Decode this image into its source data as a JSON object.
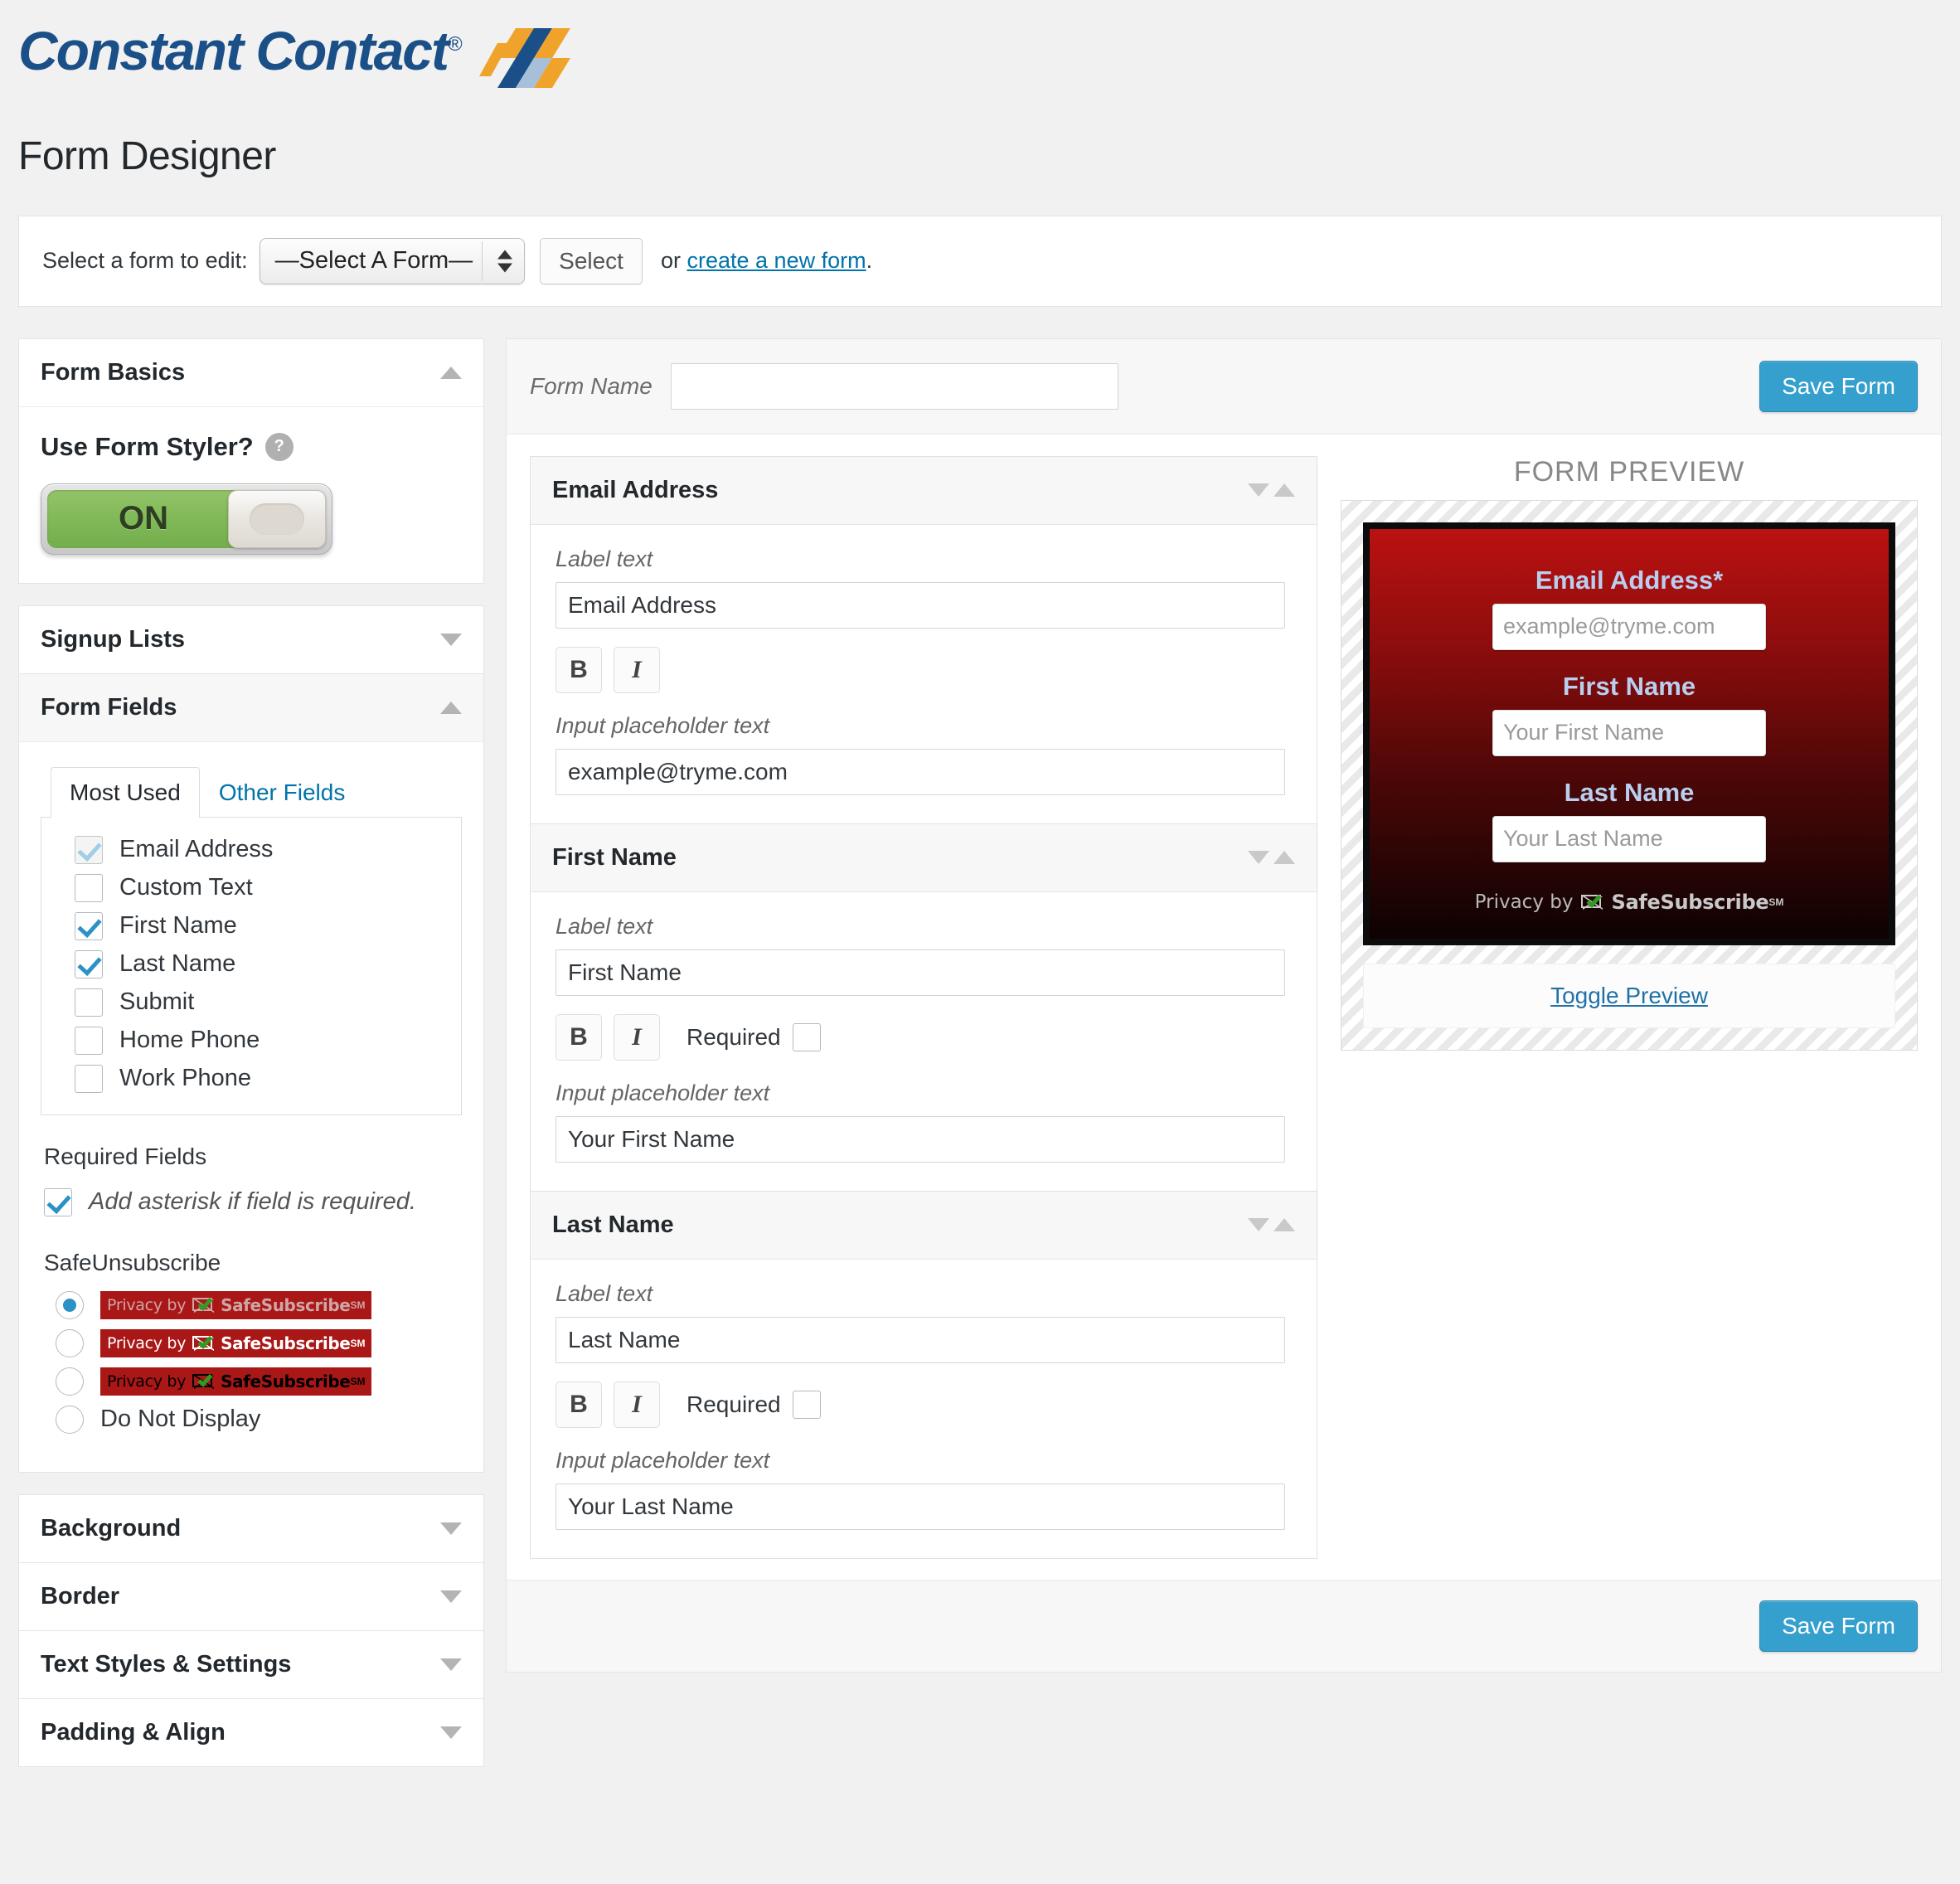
{
  "brand": {
    "name": "Constant Contact",
    "registered_mark": "®"
  },
  "page": {
    "title": "Form Designer"
  },
  "selector": {
    "label": "Select a form to edit:",
    "selected_option": "—Select A Form—",
    "options": [
      "—Select A Form—"
    ],
    "select_button": "Select",
    "or_text": "or",
    "create_link": "create a new form",
    "period": "."
  },
  "sidebar": {
    "form_basics": {
      "title": "Form Basics",
      "styler_question": "Use Form Styler?",
      "help_icon": "question-mark-icon",
      "toggle_state": "ON"
    },
    "signup_lists": {
      "title": "Signup Lists"
    },
    "form_fields": {
      "title": "Form Fields",
      "tabs": [
        {
          "label": "Most Used",
          "active": true
        },
        {
          "label": "Other Fields",
          "active": false
        }
      ],
      "checkboxes": [
        {
          "label": "Email Address",
          "checked": true,
          "disabled": true
        },
        {
          "label": "Custom Text",
          "checked": false,
          "disabled": false
        },
        {
          "label": "First Name",
          "checked": true,
          "disabled": false
        },
        {
          "label": "Last Name",
          "checked": true,
          "disabled": false
        },
        {
          "label": "Submit",
          "checked": false,
          "disabled": false
        },
        {
          "label": "Home Phone",
          "checked": false,
          "disabled": false
        },
        {
          "label": "Work Phone",
          "checked": false,
          "disabled": false
        }
      ],
      "required_fields_title": "Required Fields",
      "asterisk_label": "Add asterisk if field is required.",
      "asterisk_checked": true,
      "safeunsubscribe_title": "SafeUnsubscribe",
      "badge_privacy_text": "Privacy by",
      "badge_name": "SafeSubscribe",
      "badge_sm": "SM",
      "safeunsubscribe_options": [
        {
          "style": "grey",
          "selected": true
        },
        {
          "style": "white",
          "selected": false
        },
        {
          "style": "black",
          "selected": false
        }
      ],
      "do_not_display_label": "Do Not Display",
      "do_not_display_selected": false
    },
    "collapsed_sections": [
      {
        "title": "Background"
      },
      {
        "title": "Border"
      },
      {
        "title": "Text Styles & Settings"
      },
      {
        "title": "Padding & Align"
      }
    ]
  },
  "content": {
    "form_name_label": "Form Name",
    "form_name_value": "",
    "form_name_placeholder": "",
    "save_button_top": "Save Form",
    "save_button_bottom": "Save Form",
    "label_text_label": "Label text",
    "placeholder_text_label": "Input placeholder text",
    "bold_button": "B",
    "italic_button": "I",
    "required_label": "Required",
    "fields": [
      {
        "title": "Email Address",
        "label_text": "Email Address",
        "placeholder_text": "example@tryme.com",
        "has_required": false,
        "required_checked": false
      },
      {
        "title": "First Name",
        "label_text": "First Name",
        "placeholder_text": "Your First Name",
        "has_required": true,
        "required_checked": false
      },
      {
        "title": "Last Name",
        "label_text": "Last Name",
        "placeholder_text": "Your Last Name",
        "has_required": true,
        "required_checked": false
      }
    ]
  },
  "preview": {
    "title": "FORM PREVIEW",
    "fields": [
      {
        "label": "Email Address*",
        "placeholder": "example@tryme.com"
      },
      {
        "label": "First Name",
        "placeholder": "Your First Name"
      },
      {
        "label": "Last Name",
        "placeholder": "Your Last Name"
      }
    ],
    "privacy_text": "Privacy by",
    "badge_name": "SafeSubscribe",
    "badge_sm": "SM",
    "toggle_link": "Toggle Preview"
  },
  "colors": {
    "brand_blue": "#1b4f87",
    "link_blue": "#0073aa",
    "save_button_blue": "#35a0ce",
    "toggle_green": "#7fb856",
    "badge_red": "#a91717",
    "preview_label_blue": "#b8cff0"
  }
}
